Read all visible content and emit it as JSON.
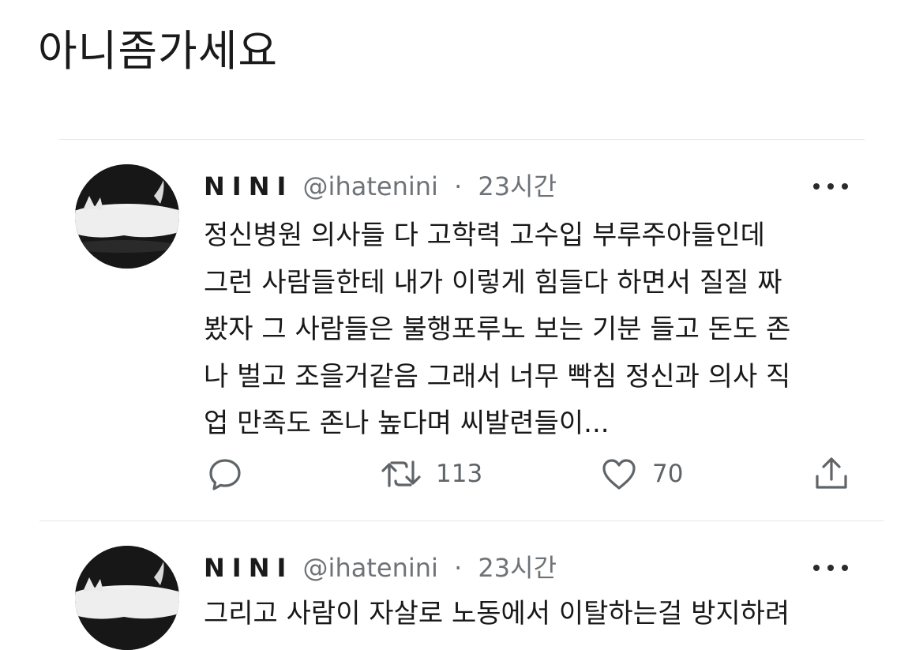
{
  "header": {
    "title": "아니좀가세요"
  },
  "tweets": [
    {
      "display_name": "NINI",
      "handle": "@ihatenini",
      "separator": "·",
      "time": "23시간",
      "avatar_icon": "cat-avatar-icon",
      "more_icon": "more-options-icon",
      "lines": [
        "정신병원 의사들 다 고학력 고수입 부루주아들인데",
        "그런 사람들한테 내가 이렇게 힘들다 하면서 질질 짜",
        "봤자 그 사람들은 불행포루노 보는 기분 들고 돈도 존",
        "나 벌고 조을거같음 그래서 너무 빡침 정신과 의사 직",
        "업 만족도 존나 높다며 씨발련들이..."
      ],
      "actions": {
        "reply_icon": "reply-icon",
        "retweet_icon": "retweet-icon",
        "retweet_count": "113",
        "like_icon": "heart-icon",
        "like_count": "70",
        "share_icon": "share-icon"
      }
    },
    {
      "display_name": "NINI",
      "handle": "@ihatenini",
      "separator": "·",
      "time": "23시간",
      "avatar_icon": "cat-avatar-icon",
      "more_icon": "more-options-icon",
      "lines": [
        "그리고 사람이 자살로 노동에서 이탈하는걸 방지하려"
      ]
    }
  ],
  "colors": {
    "text": "#181818",
    "muted": "#6e7378",
    "divider": "#e6e6e6",
    "avatar_bg": "#1a1a1a"
  }
}
